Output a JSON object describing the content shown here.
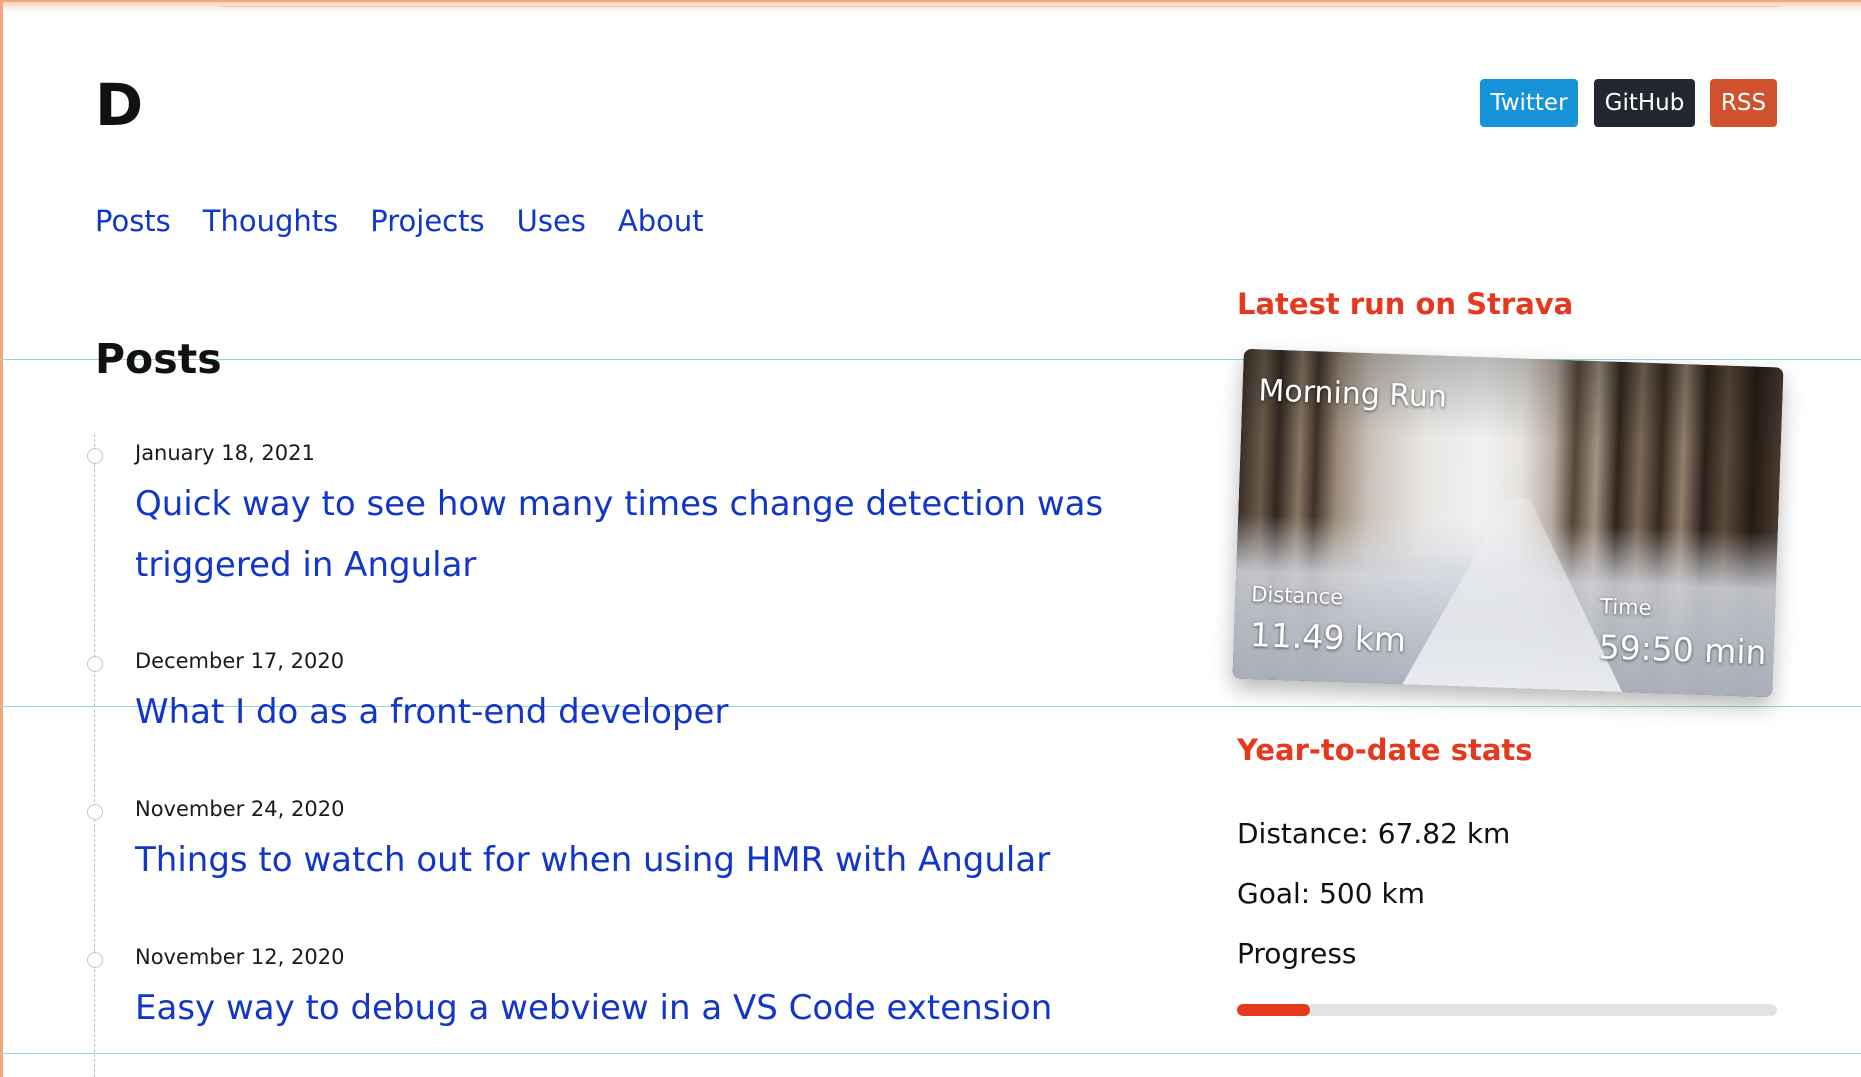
{
  "site": {
    "logo": "D"
  },
  "social": {
    "twitter": {
      "label": "Twitter",
      "color": "#1593d6"
    },
    "github": {
      "label": "GitHub",
      "color": "#23272f"
    },
    "rss": {
      "label": "RSS",
      "color": "#d0512d"
    }
  },
  "nav": {
    "items": [
      {
        "label": "Posts"
      },
      {
        "label": "Thoughts"
      },
      {
        "label": "Projects"
      },
      {
        "label": "Uses"
      },
      {
        "label": "About"
      }
    ],
    "link_color": "#1237c8"
  },
  "posts": {
    "heading": "Posts",
    "items": [
      {
        "date": "January 18, 2021",
        "title": "Quick way to see how many times change detection was triggered in Angular"
      },
      {
        "date": "December 17, 2020",
        "title": "What I do as a front-end developer"
      },
      {
        "date": "November 24, 2020",
        "title": "Things to watch out for when using HMR with Angular"
      },
      {
        "date": "November 12, 2020",
        "title": "Easy way to debug a webview in a VS Code extension"
      }
    ]
  },
  "sidebar": {
    "accent_color": "#e5391f",
    "latest_run": {
      "heading": "Latest run on Strava",
      "title": "Morning Run",
      "distance_label": "Distance",
      "distance_value": "11.49 km",
      "time_label": "Time",
      "time_value": "59:50 min"
    },
    "ytd": {
      "heading": "Year-to-date stats",
      "distance": "Distance: 67.82 km",
      "goal": "Goal: 500 km",
      "progress_label": "Progress",
      "progress_fraction": 0.1356
    }
  }
}
